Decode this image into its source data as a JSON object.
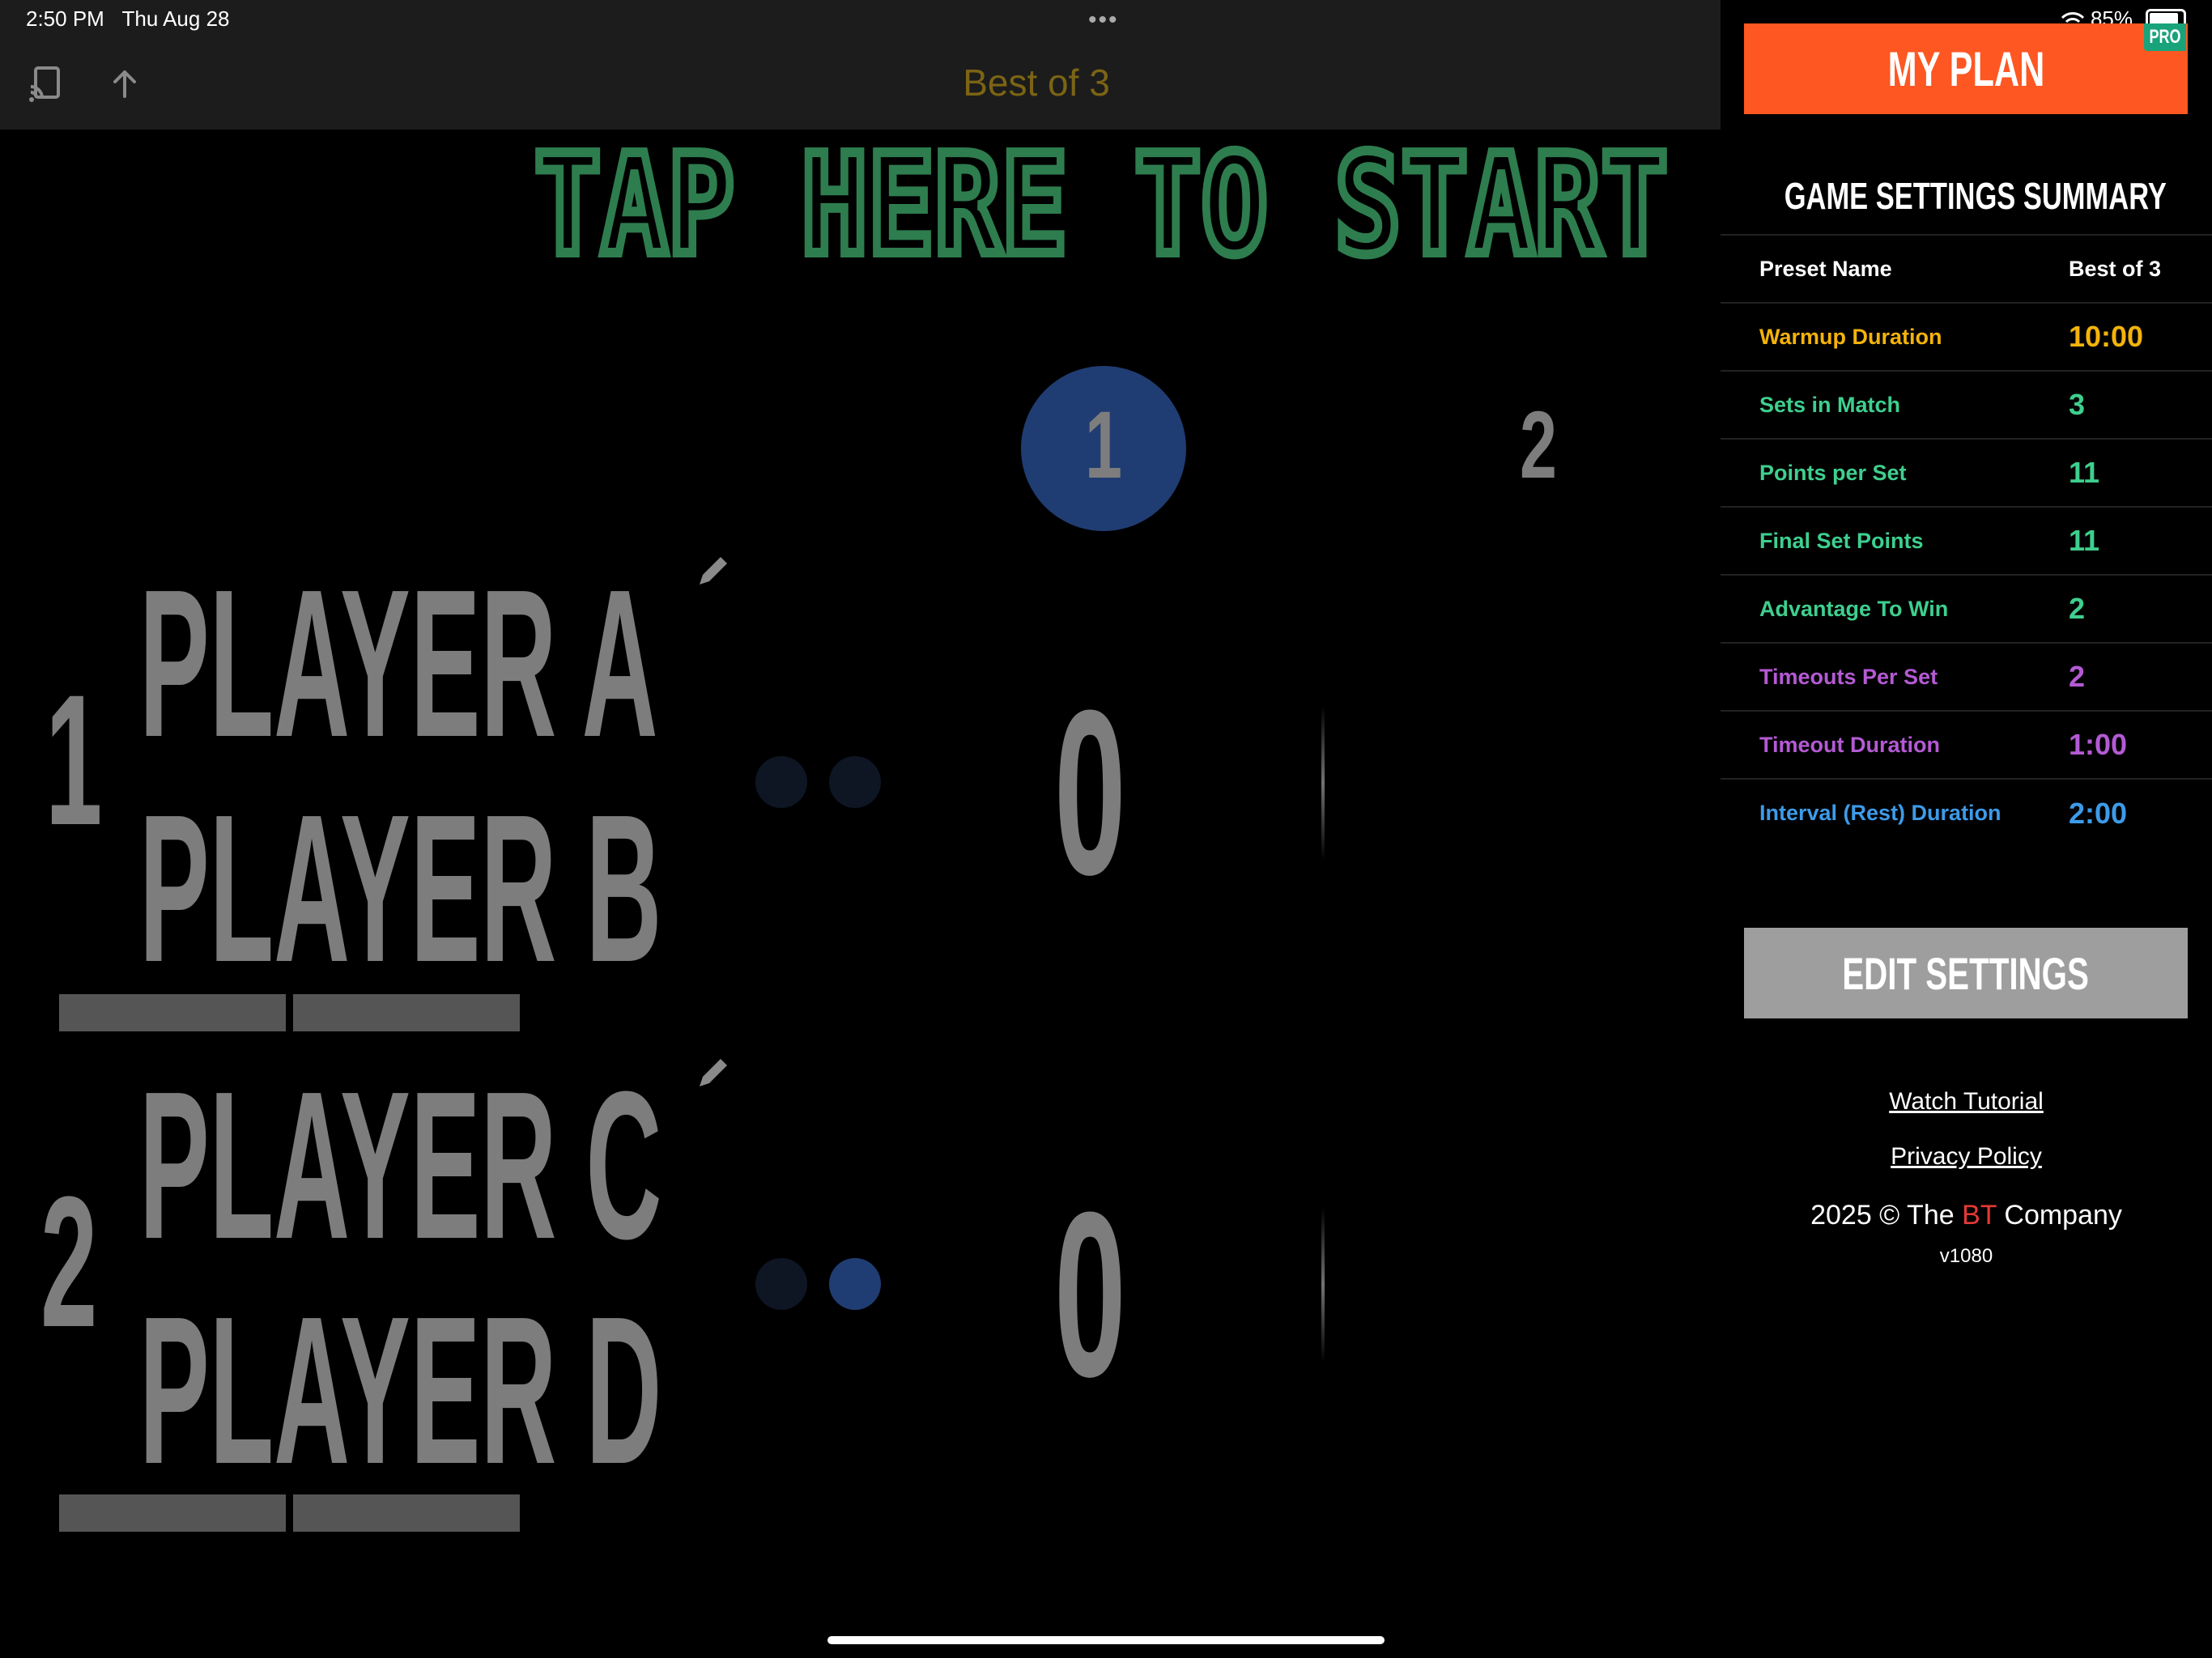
{
  "status": {
    "time": "2:50 PM",
    "date": "Thu Aug 28",
    "battery": "85%"
  },
  "nav": {
    "title": "Best of 3"
  },
  "start_banner": "TAP HERE TO START",
  "sets": {
    "labels": [
      "1",
      "2"
    ],
    "current_index": 0
  },
  "teams": [
    {
      "number": "1",
      "players": [
        "PLAYER A",
        "PLAYER B"
      ],
      "score": "0",
      "serve_dots_active": [
        false,
        false
      ]
    },
    {
      "number": "2",
      "players": [
        "PLAYER C",
        "PLAYER D"
      ],
      "score": "0",
      "serve_dots_active": [
        false,
        true
      ]
    }
  ],
  "panel": {
    "my_plan_label": "MY PLAN",
    "pro_badge": "PRO",
    "summary_title": "GAME SETTINGS SUMMARY",
    "settings": [
      {
        "key": "Preset Name",
        "value": "Best of 3",
        "color": "#ffffff"
      },
      {
        "key": "Warmup Duration",
        "value": "10:00",
        "color": "#f4b30b"
      },
      {
        "key": "Sets in Match",
        "value": "3",
        "color": "#3ecf8e"
      },
      {
        "key": "Points per Set",
        "value": "11",
        "color": "#3ecf8e"
      },
      {
        "key": "Final Set Points",
        "value": "11",
        "color": "#3ecf8e"
      },
      {
        "key": "Advantage To Win",
        "value": "2",
        "color": "#3ecf8e"
      },
      {
        "key": "Timeouts Per Set",
        "value": "2",
        "color": "#b45ad4"
      },
      {
        "key": "Timeout Duration",
        "value": "1:00",
        "color": "#b45ad4"
      },
      {
        "key": "Interval (Rest) Duration",
        "value": "2:00",
        "color": "#3d9be9"
      }
    ],
    "edit_settings_label": "EDIT SETTINGS",
    "watch_tutorial": "Watch Tutorial",
    "privacy_policy": "Privacy Policy",
    "copyright_prefix": "2025 © The ",
    "copyright_brand": "BT",
    "copyright_suffix": " Company",
    "version": "v1080"
  },
  "colors": {
    "accent_orange": "#fe5722",
    "pro_green": "#19a37a",
    "set_blue": "#1f3d72",
    "banner_green": "#2e7d4f",
    "title_gold": "#7b6414"
  },
  "icons": [
    "cast-icon",
    "share-icon",
    "edit-icon",
    "wifi-icon",
    "battery-icon"
  ]
}
